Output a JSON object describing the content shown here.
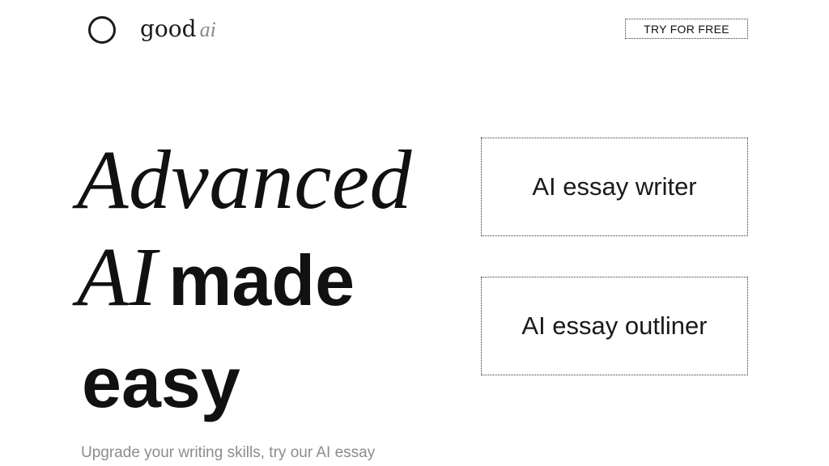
{
  "header": {
    "logo_word": "good",
    "logo_suffix": "ai",
    "cta_label": "TRY FOR FREE"
  },
  "hero": {
    "line1_italic": "Advanced",
    "line2_italic": "AI",
    "line2_bold": "made",
    "line3_bold": "easy",
    "subtitle": "Upgrade your writing skills, try our AI essay"
  },
  "tools": [
    {
      "label": "AI essay writer"
    },
    {
      "label": "AI essay outliner"
    }
  ]
}
